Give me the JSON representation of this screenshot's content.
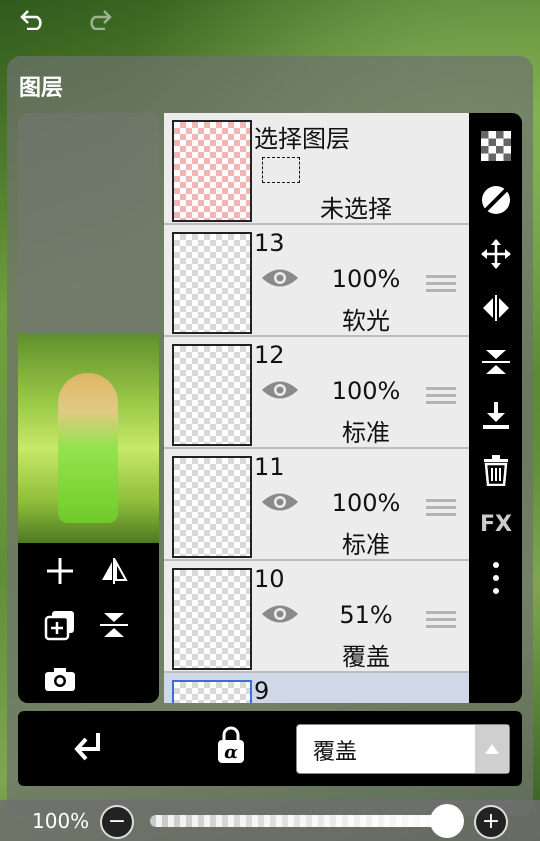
{
  "panel": {
    "title": "图层"
  },
  "selection_layer": {
    "title": "选择图层",
    "state": "未选择"
  },
  "layers": [
    {
      "number": "13",
      "opacity": "100%",
      "blend": "软光"
    },
    {
      "number": "12",
      "opacity": "100%",
      "blend": "标准"
    },
    {
      "number": "11",
      "opacity": "100%",
      "blend": "标准"
    },
    {
      "number": "10",
      "opacity": "51%",
      "blend": "覆盖"
    },
    {
      "number": "9"
    }
  ],
  "right_tools": {
    "fx_label": "FX"
  },
  "bottom": {
    "blend_mode": "覆盖"
  },
  "opacity_bar": {
    "value": "100%",
    "level": 1.0
  },
  "colors": {
    "accent_selected": "#3a6fd8",
    "panel_bg": "#6e736e"
  },
  "icons": [
    "undo-icon",
    "redo-icon",
    "add-layer-icon",
    "flip-horizontal-icon",
    "copy-layer-icon",
    "flip-vertical-icon",
    "camera-icon",
    "checker-icon",
    "circle-half-icon",
    "move-icon",
    "mirror-icon",
    "merge-down-icon",
    "trash-icon",
    "more-icon",
    "clip-arrow-icon",
    "alpha-lock-icon",
    "eye-icon",
    "minus-icon",
    "plus-icon"
  ]
}
